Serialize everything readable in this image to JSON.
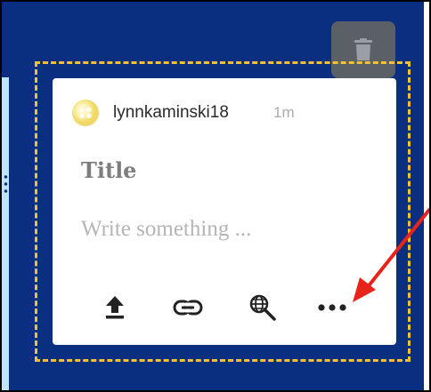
{
  "post": {
    "username": "lynnkaminski18",
    "timestamp": "1m",
    "title_placeholder": "Title",
    "body_placeholder": "Write something ..."
  },
  "toolbar": {
    "items": [
      {
        "icon": "upload-icon"
      },
      {
        "icon": "link-icon"
      },
      {
        "icon": "search-web-icon"
      },
      {
        "icon": "more-options-icon"
      }
    ]
  },
  "colors": {
    "background": "#0b2f80",
    "outline": "#f2c233",
    "annotation_arrow": "#e8231a",
    "delete_button": "#5b5f66"
  }
}
